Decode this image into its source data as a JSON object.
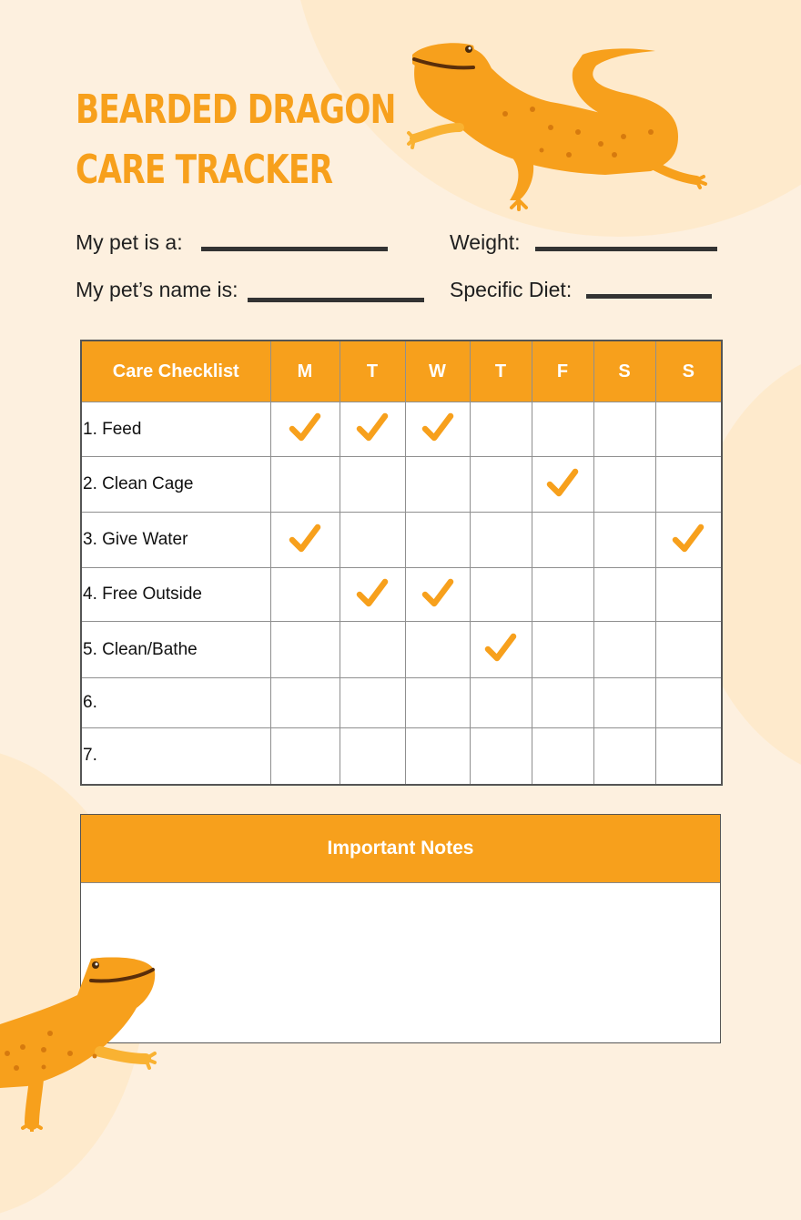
{
  "title": {
    "line1": "BEARDED DRAGON",
    "line2": "CARE TRACKER"
  },
  "fields": [
    {
      "label": "My pet is a:",
      "value": ""
    },
    {
      "label": "Weight:",
      "value": ""
    },
    {
      "label": "My pet’s name is:",
      "value": ""
    },
    {
      "label": "Specific Diet:",
      "value": ""
    }
  ],
  "checklist": {
    "header": "Care Checklist",
    "days": [
      "M",
      "T",
      "W",
      "T",
      "F",
      "S",
      "S"
    ],
    "rows": [
      {
        "task": "1. Feed",
        "checks": [
          true,
          true,
          true,
          false,
          false,
          false,
          false
        ]
      },
      {
        "task": "2. Clean Cage",
        "checks": [
          false,
          false,
          false,
          false,
          true,
          false,
          false
        ]
      },
      {
        "task": "3. Give Water",
        "checks": [
          true,
          false,
          false,
          false,
          false,
          false,
          true
        ]
      },
      {
        "task": "4. Free Outside",
        "checks": [
          false,
          true,
          true,
          false,
          false,
          false,
          false
        ]
      },
      {
        "task": "5. Clean/Bathe",
        "checks": [
          false,
          false,
          false,
          true,
          false,
          false,
          false
        ]
      },
      {
        "task": "6.",
        "checks": [
          false,
          false,
          false,
          false,
          false,
          false,
          false
        ]
      },
      {
        "task": "7.",
        "checks": [
          false,
          false,
          false,
          false,
          false,
          false,
          false
        ]
      }
    ]
  },
  "notes": {
    "header": "Important Notes",
    "content": ""
  },
  "colors": {
    "accent": "#f7a01c",
    "background": "#fdf0df",
    "blob": "#feeacc",
    "text": "#1f1f1f"
  },
  "icons": {
    "check": "checkmark-icon",
    "mascot": "bearded-dragon-illustration"
  }
}
